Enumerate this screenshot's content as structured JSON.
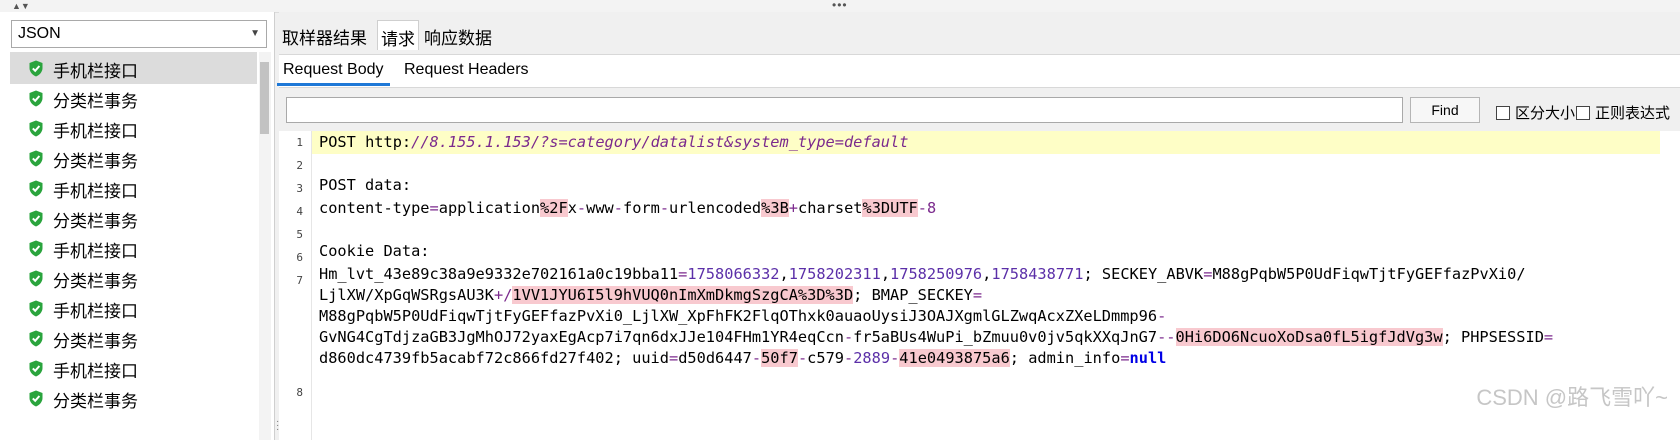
{
  "left_pane": {
    "format_select": "JSON",
    "items": [
      {
        "label": "手机栏接口"
      },
      {
        "label": "分类栏事务"
      },
      {
        "label": "手机栏接口"
      },
      {
        "label": "分类栏事务"
      },
      {
        "label": "手机栏接口"
      },
      {
        "label": "分类栏事务"
      },
      {
        "label": "手机栏接口"
      },
      {
        "label": "分类栏事务"
      },
      {
        "label": "手机栏接口"
      },
      {
        "label": "分类栏事务"
      },
      {
        "label": "手机栏接口"
      },
      {
        "label": "分类栏事务"
      }
    ]
  },
  "tabs": {
    "sampler_result": "取样器结果",
    "request": "请求",
    "response_data": "响应数据"
  },
  "subtabs": {
    "request_body": "Request Body",
    "request_headers": "Request Headers"
  },
  "find": {
    "value": "",
    "button": "Find",
    "case_sensitive": "区分大小写",
    "regex": "正则表达式"
  },
  "editor": {
    "line_numbers": [
      "1",
      "2",
      "3",
      "4",
      "5",
      "6",
      "7",
      "8"
    ],
    "line1_method": "POST ",
    "line1_scheme": "http:",
    "line1_url": "//8.155.1.153/?s=category/datalist&system_type=default",
    "line3": "POST data:",
    "line4": {
      "a": "content-type",
      "b": "=",
      "c": "application",
      "d": "%2F",
      "e": "x",
      "f": "-",
      "g": "www",
      "h": "-",
      "i": "form",
      "j": "-",
      "k": "urlencoded",
      "l": "%3B",
      "m": "+",
      "n": "charset",
      "o": "%3DUTF",
      "p": "-8"
    },
    "line6": "Cookie Data:",
    "line7": {
      "r1a": "Hm_lvt_43e89c38a9e9332e702161a0c19bba11",
      "r1b": "=",
      "r1c": "1758066332",
      "r1d": ",",
      "r1e": "1758202311",
      "r1f": ",",
      "r1g": "1758250976",
      "r1h": ",",
      "r1i": "1758438771",
      "r1j": "; SECKEY_ABVK",
      "r1k": "=",
      "r1l": "M88gPqbW5P0UdFiqwTjtFyGEFfazPvXi0/",
      "r2a": "LjlXW/XpGqWSRgsAU3K",
      "r2b": "+/",
      "r2c": "1VV1JYU6I5l9hVUQ0nImXmDkmgSzgCA",
      "r2d": "%3D%3D",
      "r2e": "; BMAP_SECKEY",
      "r2f": "=",
      "r3a": "M88gPqbW5P0UdFiqwTjtFyGEFfazPvXi0_LjlXW_XpFhFK2FlqOThxk0auaoUysiJ3OAJXgmlGLZwqAcxZXeLDmmp96",
      "r3b": "-",
      "r4a": "GvNG4CgTdjzaGB3JgMhOJ72yaxEgAcp7i7qn6dxJJe104FHm1YR4eqCcn",
      "r4b": "-",
      "r4c": "fr5aBUs4WuPi_bZmuu0v0jv5qkXXqJnG7",
      "r4d": "--",
      "r4e": "0Hi6DO6NcuoXoDsa0fL5igfJdVg3w",
      "r4f": "; PHPSESSID",
      "r4g": "=",
      "r5a": "d860dc4739fb5acabf72c866fd27f402; uuid",
      "r5b": "=",
      "r5c": "d50d6447",
      "r5d": "-",
      "r5e": "50f7",
      "r5f": "-",
      "r5g": "c579",
      "r5h": "-",
      "r5i": "2889",
      "r5j": "-",
      "r5k": "41e0493875a6",
      "r5l": "; admin_info",
      "r5m": "=",
      "r5n": "null"
    }
  },
  "watermark": "CSDN @路飞雪吖~",
  "colors": {
    "tab_underline": "#1e78d7",
    "current_line": "#fefec6",
    "shield_green": "#2aa43d",
    "highlight_pink": "#f8c9cf",
    "keyword_blue": "#0000e6",
    "url_purple": "#7b2a8d"
  },
  "icons": {
    "tree_item": "shield-check-icon"
  }
}
